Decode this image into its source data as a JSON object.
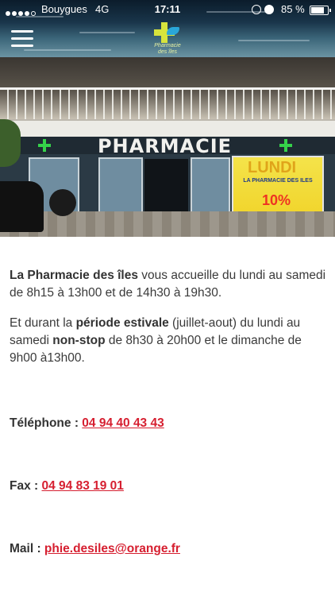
{
  "status_bar": {
    "carrier": "Bouygues",
    "network": "4G",
    "time": "17:11",
    "battery": "85 %",
    "battery_level": 0.85
  },
  "header": {
    "menu_icon": "hamburger-icon",
    "logo_text": "Pharmacie des îles"
  },
  "hero": {
    "sign_text": "PHARMACIE",
    "poster_day": "LUNDI",
    "poster_text": "LA PHARMACIE DES ILES",
    "poster_percent": "10%"
  },
  "intro": {
    "p1_bold": "La Pharmacie des îles",
    "p1_rest": " vous accueille du lundi au samedi de 8h15 à 13h00 et de 14h30 à 19h30.",
    "p2_a": "Et durant la ",
    "p2_bold1": "période estivale",
    "p2_b": " (juillet-aout) du lundi au samedi ",
    "p2_bold2": "non-stop",
    "p2_c": " de 8h30 à 20h00 et le dimanche de 9h00 à13h00."
  },
  "contact": {
    "phone_label": "Téléphone : ",
    "phone_value": "04 94 40 43 43",
    "fax_label": "Fax  : ",
    "fax_value": "04 94 83 19 01",
    "mail_label": "Mail : ",
    "mail_value": "phie.desiles@orange.fr"
  },
  "colors": {
    "link": "#d61f30",
    "text": "#333333",
    "logo_cross": "#d7e43c"
  }
}
